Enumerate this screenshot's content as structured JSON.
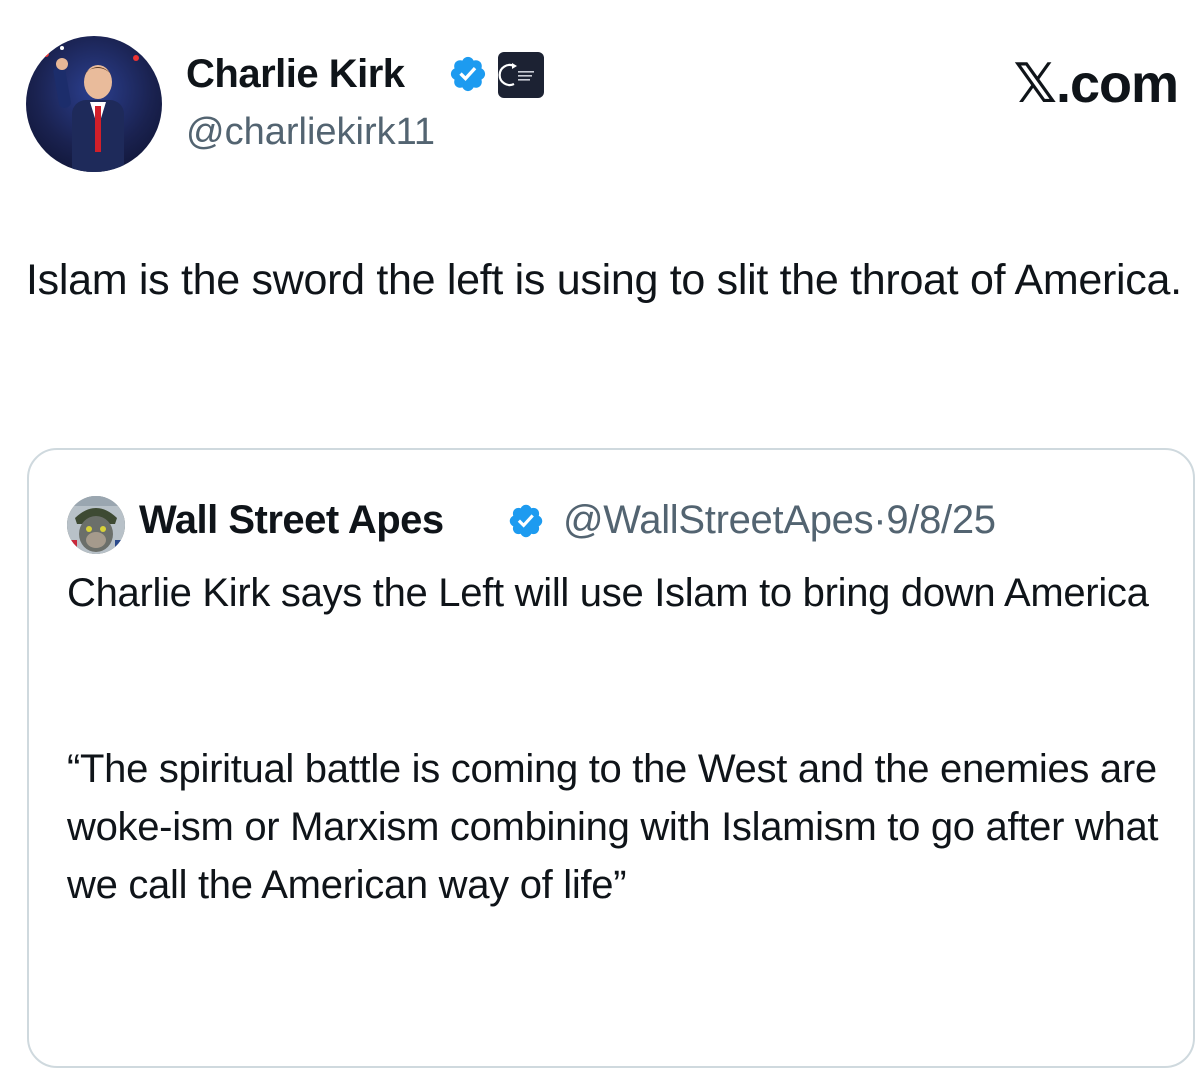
{
  "tweet": {
    "author": {
      "name": "Charlie Kirk",
      "handle": "@charliekirk11",
      "verified": true,
      "org_badge_icon": "organization-badge-icon"
    },
    "site_mark": "𝕏.com",
    "text": "Islam is the sword the left is using to slit the throat of America."
  },
  "quote": {
    "author": {
      "name": "Wall Street Apes",
      "handle": "@WallStreetApes",
      "verified": true
    },
    "separator": "·",
    "date": "9/8/25",
    "text": "Charlie Kirk says the Left will use Islam to bring down America",
    "quote_text": "“The spiritual battle is coming to the West and the enemies are woke-ism or Marxism combining with Islamism to go after what we call the American way of life”"
  },
  "colors": {
    "text_primary": "#0f1419",
    "text_secondary": "#536471",
    "verified_blue": "#1d9bf0",
    "card_border": "#cfd9de"
  }
}
